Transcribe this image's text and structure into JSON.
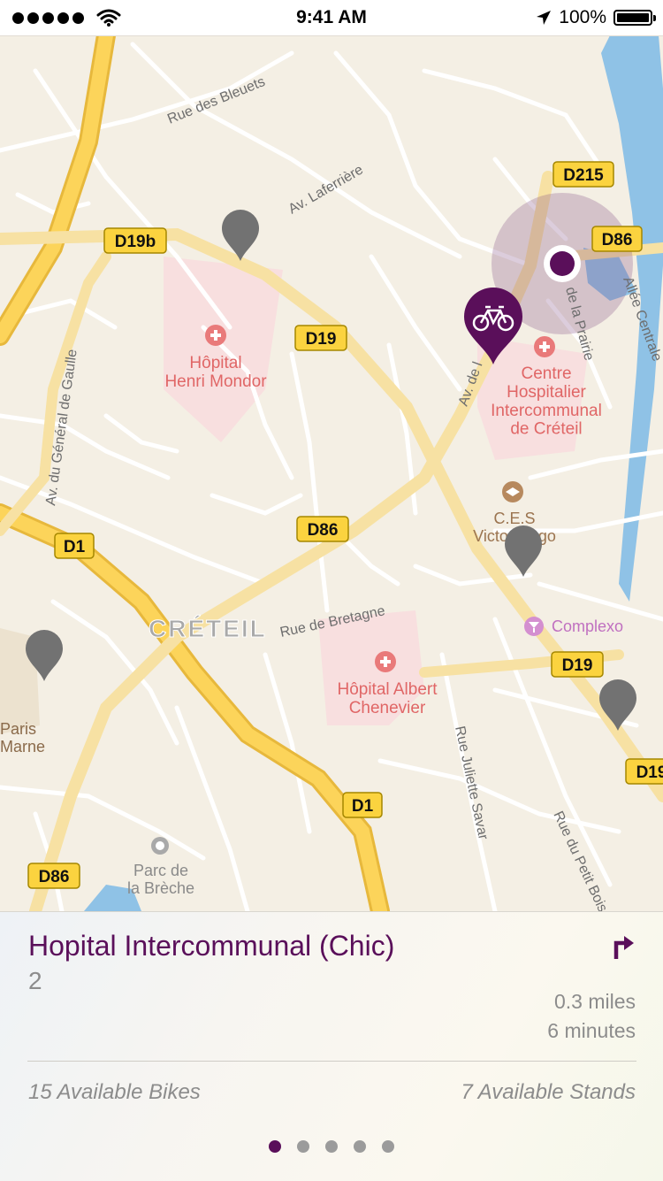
{
  "status_bar": {
    "time": "9:41 AM",
    "battery": "100%",
    "icons": [
      "signal-dots-icon",
      "wifi-icon",
      "location-arrow-icon",
      "battery-icon"
    ]
  },
  "map": {
    "road_badges": [
      "D215",
      "D86",
      "D19b",
      "D19",
      "D1",
      "D86",
      "D19",
      "D1",
      "D86",
      "D19"
    ],
    "place_labels": {
      "hopital_mondor": "Hôpital\nHenri Mondor",
      "chic": "Centre\nHospitalier\nIntercommunal\nde Créteil",
      "ces": "C.E.S\nVictor Hugo",
      "complexo": "Complexo",
      "hopital_chenevier": "Hôpital Albert\nChenevier",
      "parc": "Parc de\nla Brèche",
      "paris_marne": "Paris\nMarne",
      "city": "CRÉTEIL"
    },
    "street_labels": {
      "bleuets": "Rue des Bleuets",
      "laferriere": "Av. Laferrière",
      "gaulle": "Av. du Général de Gaulle",
      "bretagne": "Rue de Bretagne",
      "savar": "Rue Juliette Savar",
      "petit_bois": "Rue du Petit Bois",
      "centrale": "Allée Centrale",
      "prairie": "de la Prairie",
      "av_de": "Av. de l"
    },
    "colors": {
      "land": "#f4efe4",
      "road_major": "#fcd45a",
      "road_minor": "#ffffff",
      "water": "#8fc2e6",
      "hospital_zone": "#f8dfdf",
      "accent": "#5a0f5a",
      "pin_inactive": "#727272"
    }
  },
  "station": {
    "name": "Hopital Intercommunal (Chic)",
    "number": "2",
    "distance": "0.3 miles",
    "duration": "6 minutes",
    "bikes": "15 Available Bikes",
    "stands": "7 Available Stands",
    "directions_icon": "turn-right-arrow-icon"
  },
  "pager": {
    "total": 5,
    "active_index": 0
  }
}
